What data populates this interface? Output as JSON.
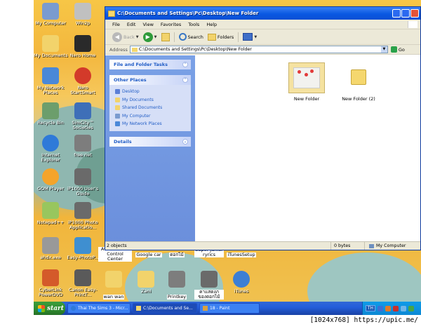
{
  "desktop": {
    "icons": [
      {
        "label": "My Computer",
        "color": "#7a9bcf"
      },
      {
        "label": "Win2p",
        "color": "#c0c0c0"
      },
      {
        "label": "My Documents",
        "color": "#f2d36b"
      },
      {
        "label": "Nero Home",
        "color": "#2a2a2a"
      },
      {
        "label": "My Network Places",
        "color": "#4a88d8"
      },
      {
        "label": "Nero StartSmart",
        "color": "#d33a2a"
      },
      {
        "label": "Recycle Bin",
        "color": "#6c9e6c"
      },
      {
        "label": "SimCity™ Societies",
        "color": "#3e6fb8"
      },
      {
        "label": "Internet Explorer",
        "color": "#2f7ad8"
      },
      {
        "label": "free net",
        "color": "#7d7d7d"
      },
      {
        "label": "GOM Player",
        "color": "#f4a42b"
      },
      {
        "label": "iP1000 User's Guide",
        "color": "#6a6a6a"
      },
      {
        "label": "Notepad++",
        "color": "#98c65e"
      },
      {
        "label": "iP1000 Photo Applicatio...",
        "color": "#6a6a6a"
      },
      {
        "label": "ahdx.exe",
        "color": "#999999"
      },
      {
        "label": "Easy-PhotoP...",
        "color": "#3f8fd0"
      },
      {
        "label": "CyberLink PowerDVD",
        "color": "#d45a2a"
      },
      {
        "label": "Canon Easy-PrintT...",
        "color": "#5a5a5a"
      }
    ],
    "bottom_icons": [
      {
        "label": "Avira AntiVir Control Center",
        "color": "#c9302c"
      },
      {
        "label": "Google car",
        "color": "#4a8ad8"
      },
      {
        "label": "ดอกไม้",
        "color": "#f2d36b"
      },
      {
        "label": "Super Junior ryrics",
        "color": "#f2d36b"
      },
      {
        "label": "iTunesSetup",
        "color": "#6a6a6a"
      },
      {
        "label": "wan wan",
        "color": "#f2d36b"
      },
      {
        "label": "Zani",
        "color": "#f2d36b"
      },
      {
        "label": "Printkey",
        "color": "#7d7d7d"
      },
      {
        "label": "คาแสดงภ ของดอกไม้",
        "color": "#6a6a6a"
      },
      {
        "label": "iTunes",
        "color": "#3c7fd4"
      }
    ]
  },
  "window": {
    "title": "C:\\Documents and Settings\\Pc\\Desktop\\New Folder",
    "menu": [
      "File",
      "Edit",
      "View",
      "Favorites",
      "Tools",
      "Help"
    ],
    "toolbar": {
      "back_label": "Back",
      "search_label": "Search",
      "folders_label": "Folders"
    },
    "address": {
      "label": "Address",
      "value": "C:\\Documents and Settings\\Pc\\Desktop\\New Folder",
      "go_label": "Go"
    },
    "tasks": {
      "file_folder_tasks": "File and Folder Tasks",
      "other_places": "Other Places",
      "places": [
        {
          "label": "Desktop",
          "color": "#5b7fd6"
        },
        {
          "label": "My Documents",
          "color": "#f2d36b"
        },
        {
          "label": "Shared Documents",
          "color": "#f2d36b"
        },
        {
          "label": "My Computer",
          "color": "#7a9bcf"
        },
        {
          "label": "My Network Places",
          "color": "#4a88d8"
        }
      ],
      "details": "Details"
    },
    "files": [
      {
        "label": "New Folder"
      },
      {
        "label": "New Folder (2)"
      }
    ],
    "status": {
      "objects": "2 objects",
      "size": "0 bytes",
      "location": "My Computer"
    }
  },
  "taskbar": {
    "start_label": "start",
    "tasks": [
      {
        "label": "Thai The Sims 3 - Micr..."
      },
      {
        "label": "C:\\Documents and Se..."
      },
      {
        "label": "18 - Paint"
      }
    ],
    "tray": {
      "language": "TH",
      "clock": ""
    }
  },
  "watermark": "[1024x768] https://upic.me/"
}
